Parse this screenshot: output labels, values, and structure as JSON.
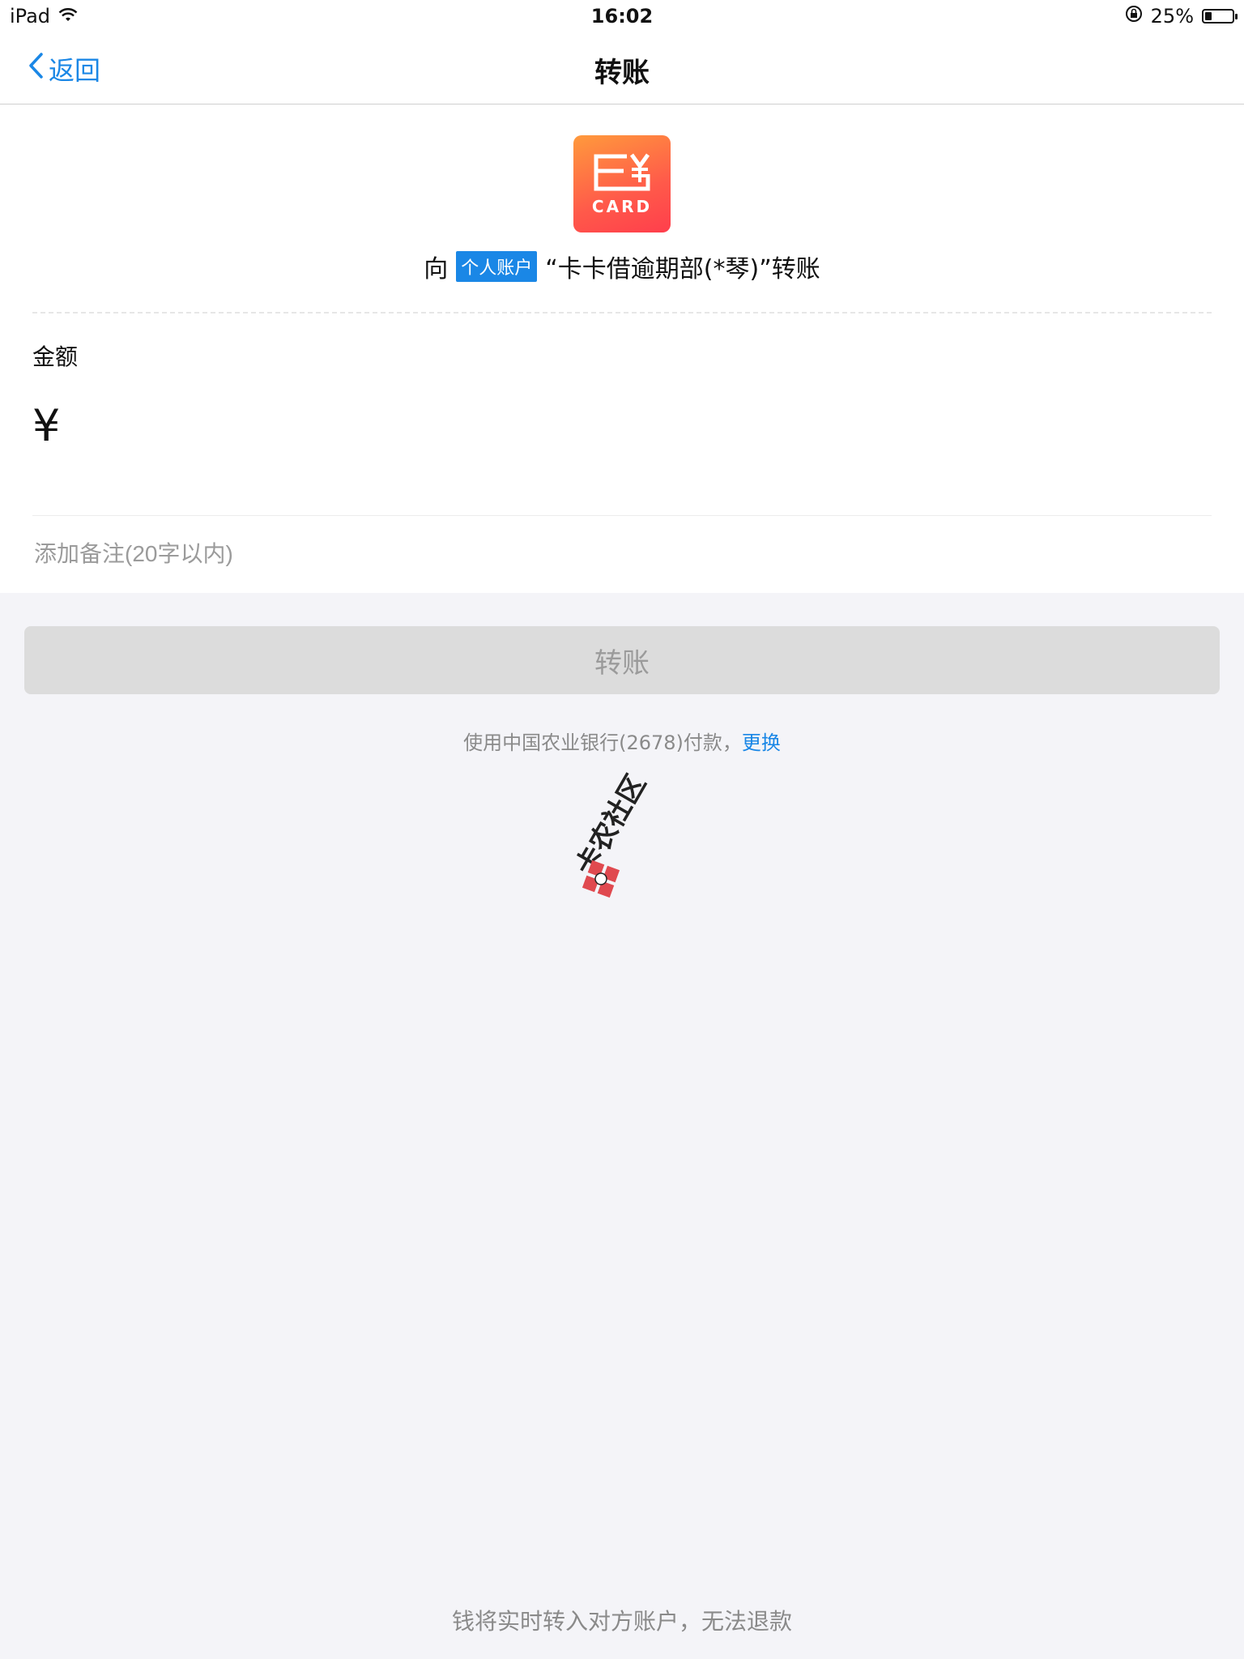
{
  "status_bar": {
    "device": "iPad",
    "time": "16:02",
    "battery": "25%",
    "battery_level": 0.25
  },
  "nav": {
    "back_label": "返回",
    "title": "转账"
  },
  "payee": {
    "logo_text": "CARD",
    "prefix": "向",
    "account_type": "个人账户",
    "name": "“卡卡借逾期部(*琴)”转账"
  },
  "amount": {
    "label": "金额",
    "currency_symbol": "¥",
    "value": ""
  },
  "remark": {
    "placeholder": "添加备注(20字以内)",
    "value": ""
  },
  "actions": {
    "transfer_label": "转账"
  },
  "payment": {
    "text": "使用中国农业银行(2678)付款，",
    "change_label": "更换"
  },
  "watermark_text": "卡农社区",
  "footer": {
    "note": "钱将实时转入对方账户，无法退款"
  },
  "colors": {
    "accent": "#1a87e6",
    "logo_gradient_start": "#ff9a3c",
    "logo_gradient_end": "#ff3e4c",
    "button_disabled": "#dcdcdc"
  }
}
